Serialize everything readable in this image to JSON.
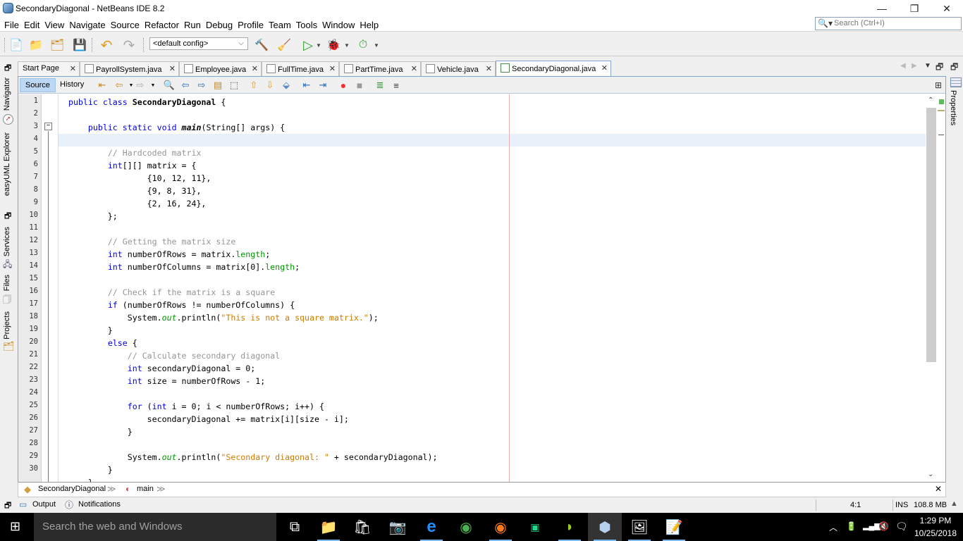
{
  "window": {
    "title": "SecondaryDiagonal - NetBeans IDE 8.2",
    "controls": {
      "minimize": "—",
      "restore": "❐",
      "close": "✕"
    }
  },
  "menu": [
    "File",
    "Edit",
    "View",
    "Navigate",
    "Source",
    "Refactor",
    "Run",
    "Debug",
    "Profile",
    "Team",
    "Tools",
    "Window",
    "Help"
  ],
  "search": {
    "placeholder": "Search (Ctrl+I)"
  },
  "toolbar": {
    "config_value": "<default config>",
    "buttons": [
      "new-file",
      "new-project",
      "open-project",
      "save-all",
      "undo",
      "redo",
      "build",
      "clean-build",
      "run",
      "debug",
      "profile"
    ]
  },
  "left_dock": [
    "Navigator",
    "easyUML Explorer",
    "Services",
    "Files",
    "Projects"
  ],
  "right_dock": [
    "Properties"
  ],
  "tabs": [
    {
      "label": "Start Page",
      "active": false
    },
    {
      "label": "PayrollSystem.java",
      "active": false
    },
    {
      "label": "Employee.java",
      "active": false
    },
    {
      "label": "FullTime.java",
      "active": false
    },
    {
      "label": "PartTime.java",
      "active": false
    },
    {
      "label": "Vehicle.java",
      "active": false
    },
    {
      "label": "SecondaryDiagonal.java",
      "active": true
    }
  ],
  "editor_toolbar": {
    "source": "Source",
    "history": "History"
  },
  "code": {
    "current_line": 4,
    "line_numbers": [
      "1",
      "2",
      "3",
      "4",
      "5",
      "6",
      "7",
      "8",
      "9",
      "10",
      "11",
      "12",
      "13",
      "14",
      "15",
      "16",
      "17",
      "18",
      "19",
      "20",
      "21",
      "22",
      "23",
      "24",
      "25",
      "26",
      "27",
      "28",
      "29",
      "30"
    ]
  },
  "breadcrumb": {
    "class": "SecondaryDiagonal",
    "method": "main"
  },
  "status": {
    "output": "Output",
    "notifications": "Notifications",
    "position": "4:1",
    "mode": "INS",
    "memory": "108.8 MB"
  },
  "taskbar": {
    "search_placeholder": "Search the web and Windows",
    "time": "1:29 PM",
    "date": "10/25/2018"
  }
}
